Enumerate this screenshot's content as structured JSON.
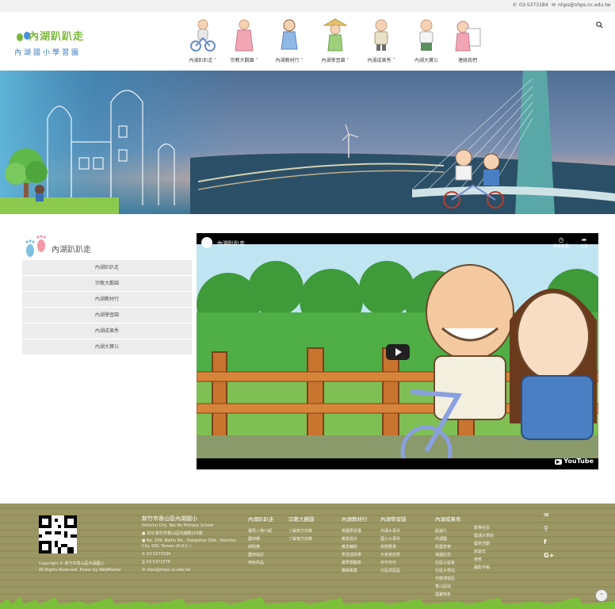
{
  "topbar": {
    "phone": "03-5373184",
    "email": "nhps@nhps.nc.edu.tw"
  },
  "header": {
    "logo_main": "內湖趴趴走",
    "logo_sub": "內湖國小學習園"
  },
  "nav": {
    "items": [
      {
        "label": "內湖趴趴走",
        "has_menu": true
      },
      {
        "label": "宗教大觀園",
        "has_menu": true
      },
      {
        "label": "內湖教材行",
        "has_menu": true
      },
      {
        "label": "內湖學習園",
        "has_menu": true
      },
      {
        "label": "內湖成果秀",
        "has_menu": true
      },
      {
        "label": "內湖大寶公",
        "has_menu": false
      },
      {
        "label": "連絡我們",
        "has_menu": false
      }
    ]
  },
  "sidebar": {
    "title": "內湖趴趴走",
    "items": [
      "內湖趴趴走",
      "宗教大觀園",
      "內湖教材行",
      "內湖學習園",
      "內湖成果秀",
      "內湖大寶公"
    ]
  },
  "video": {
    "title": "內湖趴趴走",
    "watch_later": "稍後觀看",
    "share": "分享",
    "brand": "YouTube"
  },
  "footer": {
    "copyright_line1": "Copyright © 新竹市香山區內湖國小",
    "copyright_line2": "All Rights Reserved. Power by WebMaster",
    "school_name": "新竹市香山區內湖國小",
    "school_name_en": "Hsinchu City, Nei Hu Primary School",
    "address_zh": "300 新竹市香山區內湖路109號",
    "address_en_1": "No. 109, Neihu Rd., Xiangshan Dist., Hsinchu",
    "address_en_2": "City 300, Taiwan (R.O.C.)",
    "phone": "03-5373184",
    "fax": "03-5371576",
    "email": "nhps@nhps.nc.edu.tw",
    "columns": [
      {
        "title": "內湖趴趴走",
        "items": [
          "優秀人物介紹",
          "鹽田鄉",
          "蚵殼寮",
          "鹽田採訪",
          "特色商品"
        ]
      },
      {
        "title": "宗教大觀園",
        "items": [
          "了解西方宗教",
          "了解東方宗教"
        ]
      },
      {
        "title": "內湖教材行",
        "items": [
          "校園學習書",
          "教案設計",
          "教具輔助",
          "學習成效單",
          "教學規劃表",
          "教師專業"
        ]
      },
      {
        "title": "內湖學習園",
        "items": [
          "內湖大事件",
          "國小大事件",
          "校務要事",
          "大家來找茶",
          "可可可可",
          "分區祥區區"
        ]
      },
      {
        "title": "內湖成果秀",
        "items": [
          "歐遊行",
          "內湖鹽",
          "民鹽景寫",
          "海邊紀念",
          "社區公益會",
          "社區大學站",
          "天龍漫遊區",
          "香山區站",
          "國畫特色"
        ]
      },
      {
        "title": "",
        "items": [
          "歡樂社區",
          "鹽湖大學館",
          "藝術活動",
          "旅遊去",
          "宿舍",
          "攝影手帳"
        ]
      }
    ]
  }
}
